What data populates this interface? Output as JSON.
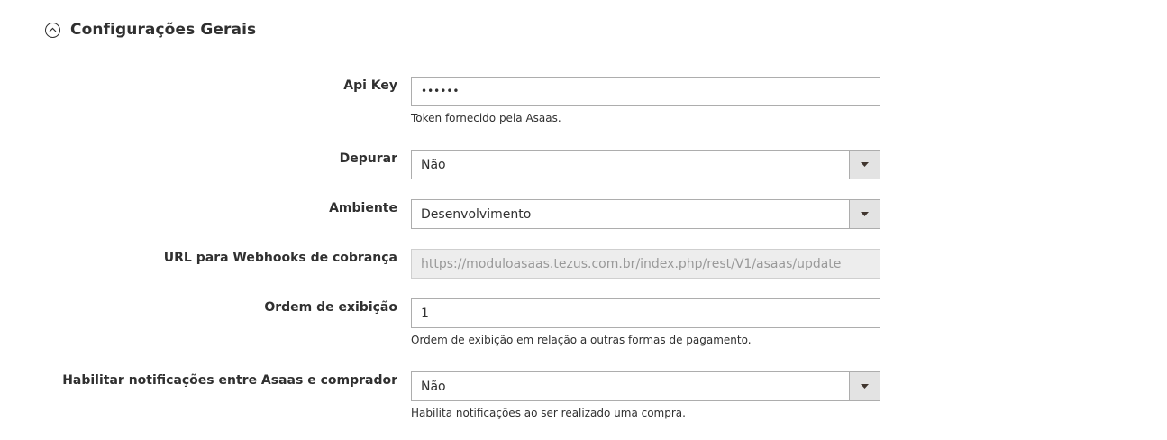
{
  "section": {
    "title": "Configurações Gerais",
    "collapse_icon": "chevron-up-circle-icon"
  },
  "fields": {
    "api_key": {
      "label": "Api Key",
      "value": "••••••",
      "note": "Token fornecido pela Asaas."
    },
    "depurar": {
      "label": "Depurar",
      "value": "Não"
    },
    "ambiente": {
      "label": "Ambiente",
      "value": "Desenvolvimento"
    },
    "webhook_url": {
      "label": "URL para Webhooks de cobrança",
      "value": "https://moduloasaas.tezus.com.br/index.php/rest/V1/asaas/update"
    },
    "ordem": {
      "label": "Ordem de exibição",
      "value": "1",
      "note": "Ordem de exibição em relação a outras formas de pagamento."
    },
    "notificacoes": {
      "label": "Habilitar notificações entre Asaas e comprador",
      "value": "Não",
      "note": "Habilita notificações ao ser realizado uma compra."
    }
  },
  "icons": {
    "select_arrow": "triangle-down-icon"
  }
}
